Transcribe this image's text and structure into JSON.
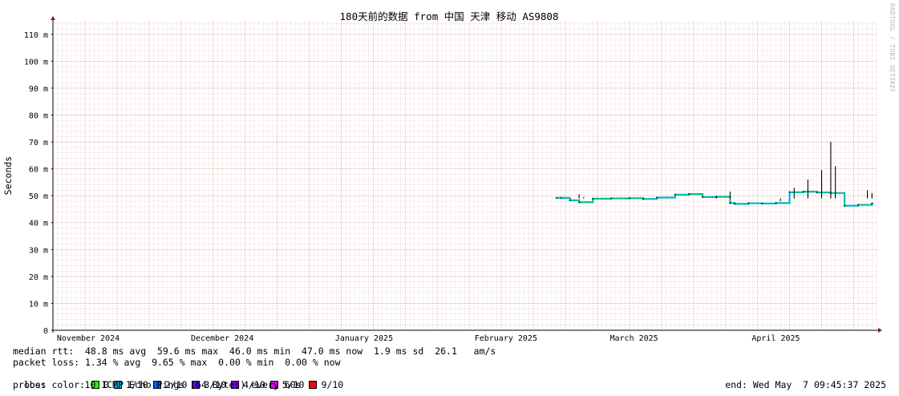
{
  "chart_data": {
    "type": "line",
    "title": "180天前的数据 from 中国 天津 移动 AS9808",
    "ylabel": "Seconds",
    "ylim": [
      0,
      115
    ],
    "y_ticks": [
      {
        "value": 0,
        "label": "0"
      },
      {
        "value": 10,
        "label": "10 m"
      },
      {
        "value": 20,
        "label": "20 m"
      },
      {
        "value": 30,
        "label": "30 m"
      },
      {
        "value": 40,
        "label": "40 m"
      },
      {
        "value": 50,
        "label": "50 m"
      },
      {
        "value": 60,
        "label": "60 m"
      },
      {
        "value": 70,
        "label": "70 m"
      },
      {
        "value": 80,
        "label": "80 m"
      },
      {
        "value": 90,
        "label": "90 m"
      },
      {
        "value": 100,
        "label": "100 m"
      },
      {
        "value": 110,
        "label": "110 m"
      }
    ],
    "x_range": [
      "2024-11-08",
      "2025-05-07"
    ],
    "x_ticks": [
      {
        "date": "2024-11-01",
        "label": "November 2024"
      },
      {
        "date": "2024-12-01",
        "label": "December 2024"
      },
      {
        "date": "2025-01-01",
        "label": "January 2025"
      },
      {
        "date": "2025-02-01",
        "label": "February 2025"
      },
      {
        "date": "2025-03-01",
        "label": "March 2025"
      },
      {
        "date": "2025-04-01",
        "label": "April 2025"
      }
    ],
    "grid": true,
    "series": [
      {
        "name": "median rtt",
        "color": "#00cc00",
        "x": [
          "2025-02-26",
          "2025-03-01",
          "2025-03-03",
          "2025-03-06",
          "2025-03-10",
          "2025-03-14",
          "2025-03-17",
          "2025-03-20",
          "2025-03-24",
          "2025-03-27",
          "2025-03-30",
          "2025-04-02",
          "2025-04-05",
          "2025-04-06",
          "2025-04-09",
          "2025-04-12",
          "2025-04-15",
          "2025-04-18",
          "2025-04-21",
          "2025-04-24",
          "2025-04-27",
          "2025-04-30",
          "2025-05-03",
          "2025-05-06"
        ],
        "values": [
          49.2,
          48.3,
          47.6,
          48.9,
          49.0,
          49.1,
          48.8,
          49.3,
          50.4,
          50.6,
          49.5,
          49.6,
          47.3,
          47.0,
          47.2,
          47.1,
          47.3,
          51.3,
          51.5,
          51.2,
          51.0,
          46.3,
          46.6,
          47.1
        ]
      },
      {
        "name": "max",
        "color": "#000000",
        "x": [
          "2025-02-27",
          "2025-03-03",
          "2025-03-04",
          "2025-04-02",
          "2025-04-05",
          "2025-04-16",
          "2025-04-19",
          "2025-04-22",
          "2025-04-25",
          "2025-04-27",
          "2025-04-28",
          "2025-05-05",
          "2025-05-06"
        ],
        "values": [
          49.5,
          50.5,
          49.5,
          49.8,
          51.5,
          48.0,
          53.0,
          56.0,
          59.6,
          70.0,
          61.0,
          52.0,
          51.0
        ]
      }
    ]
  },
  "legend": {
    "median_rtt": "median rtt:  48.8 ms avg  59.6 ms max  46.0 ms min  47.0 ms now  1.9 ms sd  26.1   am/s",
    "packet_loss": "packet loss: 1.34 % avg  9.65 % max  0.00 % min  0.00 % now",
    "loss_color_label": "loss color:",
    "loss_colors": [
      {
        "label": "0",
        "color": "#26ff00"
      },
      {
        "label": "1/10",
        "color": "#00b8ff"
      },
      {
        "label": "2/10",
        "color": "#0059ff"
      },
      {
        "label": "3/10",
        "color": "#5e00ff"
      },
      {
        "label": "4/10",
        "color": "#7e00ff"
      },
      {
        "label": "5/10",
        "color": "#dd00ff"
      },
      {
        "label": "9/10",
        "color": "#ff0000"
      }
    ],
    "probe_label": "probe:",
    "probe_text": "10 ICMP Echo Pings (64 Bytes) every 60s",
    "end": "end: Wed May  7 09:45:37 2025"
  },
  "watermark": "RRDTOOL / TOBI OETIKER"
}
